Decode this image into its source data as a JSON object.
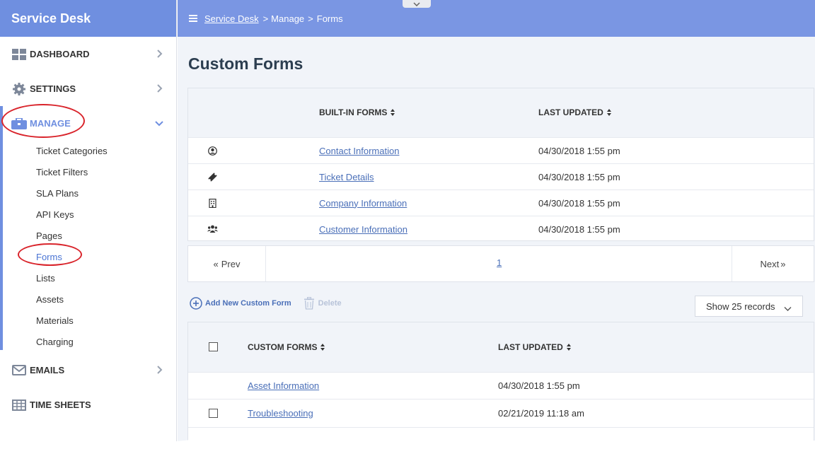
{
  "app": {
    "title": "Service Desk"
  },
  "breadcrumb": {
    "root": "Service Desk",
    "sep": ">",
    "level1": "Manage",
    "level2": "Forms"
  },
  "sidebar": {
    "items": [
      {
        "label": "DASHBOARD",
        "icon": "dashboard-icon"
      },
      {
        "label": "SETTINGS",
        "icon": "gear-icon"
      },
      {
        "label": "MANAGE",
        "icon": "briefcase-icon"
      },
      {
        "label": "EMAILS",
        "icon": "envelope-icon"
      },
      {
        "label": "TIME SHEETS",
        "icon": "table-icon"
      }
    ],
    "manage_sub": [
      "Ticket Categories",
      "Ticket Filters",
      "SLA Plans",
      "API Keys",
      "Pages",
      "Forms",
      "Lists",
      "Assets",
      "Materials",
      "Charging"
    ]
  },
  "page": {
    "title": "Custom Forms"
  },
  "builtin": {
    "col_forms": "BUILT-IN FORMS",
    "col_updated": "LAST UPDATED",
    "rows": [
      {
        "icon": "user-circle-icon",
        "name": "Contact Information",
        "updated": "04/30/2018 1:55 pm"
      },
      {
        "icon": "ticket-icon",
        "name": "Ticket Details",
        "updated": "04/30/2018 1:55 pm"
      },
      {
        "icon": "building-icon",
        "name": "Company Information",
        "updated": "04/30/2018 1:55 pm"
      },
      {
        "icon": "users-icon",
        "name": "Customer Information",
        "updated": "04/30/2018 1:55 pm"
      }
    ]
  },
  "pager": {
    "prev": "Prev",
    "page": "1",
    "next": "Next"
  },
  "actions": {
    "add": "Add New Custom Form",
    "delete": "Delete",
    "show": "Show 25 records"
  },
  "custom": {
    "col_forms": "CUSTOM FORMS",
    "col_updated": "LAST UPDATED",
    "rows": [
      {
        "name": "Asset Information",
        "updated": "04/30/2018 1:55 pm"
      },
      {
        "name": "Troubleshooting",
        "updated": "02/21/2019 11:18 am"
      }
    ]
  },
  "colors": {
    "brand": "#6f8fe0",
    "topbar": "#7a96e3",
    "link": "#4a6fb8",
    "annotation": "#d9242b"
  }
}
